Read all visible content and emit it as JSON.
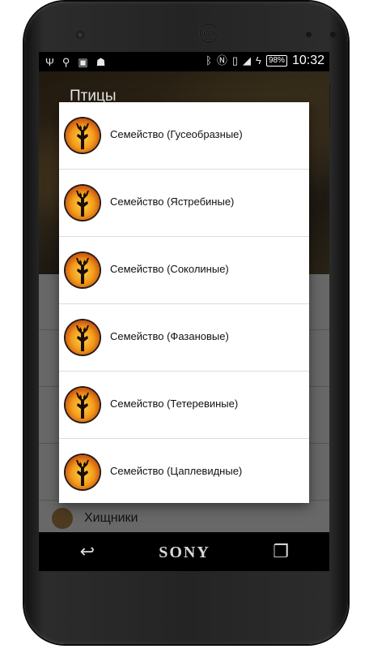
{
  "status_bar": {
    "left_icons": [
      "usb-icon",
      "search-icon",
      "image-icon",
      "android-icon"
    ],
    "right_icons": [
      "bluetooth-icon",
      "nfc-icon",
      "vibrate-icon",
      "signal-icon",
      "charging-icon"
    ],
    "battery": "98%",
    "time": "10:32"
  },
  "background": {
    "title": "Птицы",
    "bottom_item_label": "Хищники"
  },
  "dialog": {
    "items": [
      {
        "label": "Семейство (Гусеобразные)",
        "icon": "deer-icon"
      },
      {
        "label": "Семейство (Ястребиные)",
        "icon": "deer-icon"
      },
      {
        "label": "Семейство (Соколиные)",
        "icon": "deer-icon"
      },
      {
        "label": "Семейство (Фазановые)",
        "icon": "deer-icon"
      },
      {
        "label": "Семейство (Тетеревиные)",
        "icon": "deer-icon"
      },
      {
        "label": "Семейство (Цаплевидные)",
        "icon": "deer-icon"
      }
    ]
  },
  "device": {
    "brand": "SONY",
    "nav_icons": [
      "back-icon",
      "home-icon",
      "recents-icon"
    ]
  },
  "colors": {
    "dialog_bg": "#ffffff",
    "icon_orange": "#f29a1a",
    "status_bar": "#000000"
  }
}
